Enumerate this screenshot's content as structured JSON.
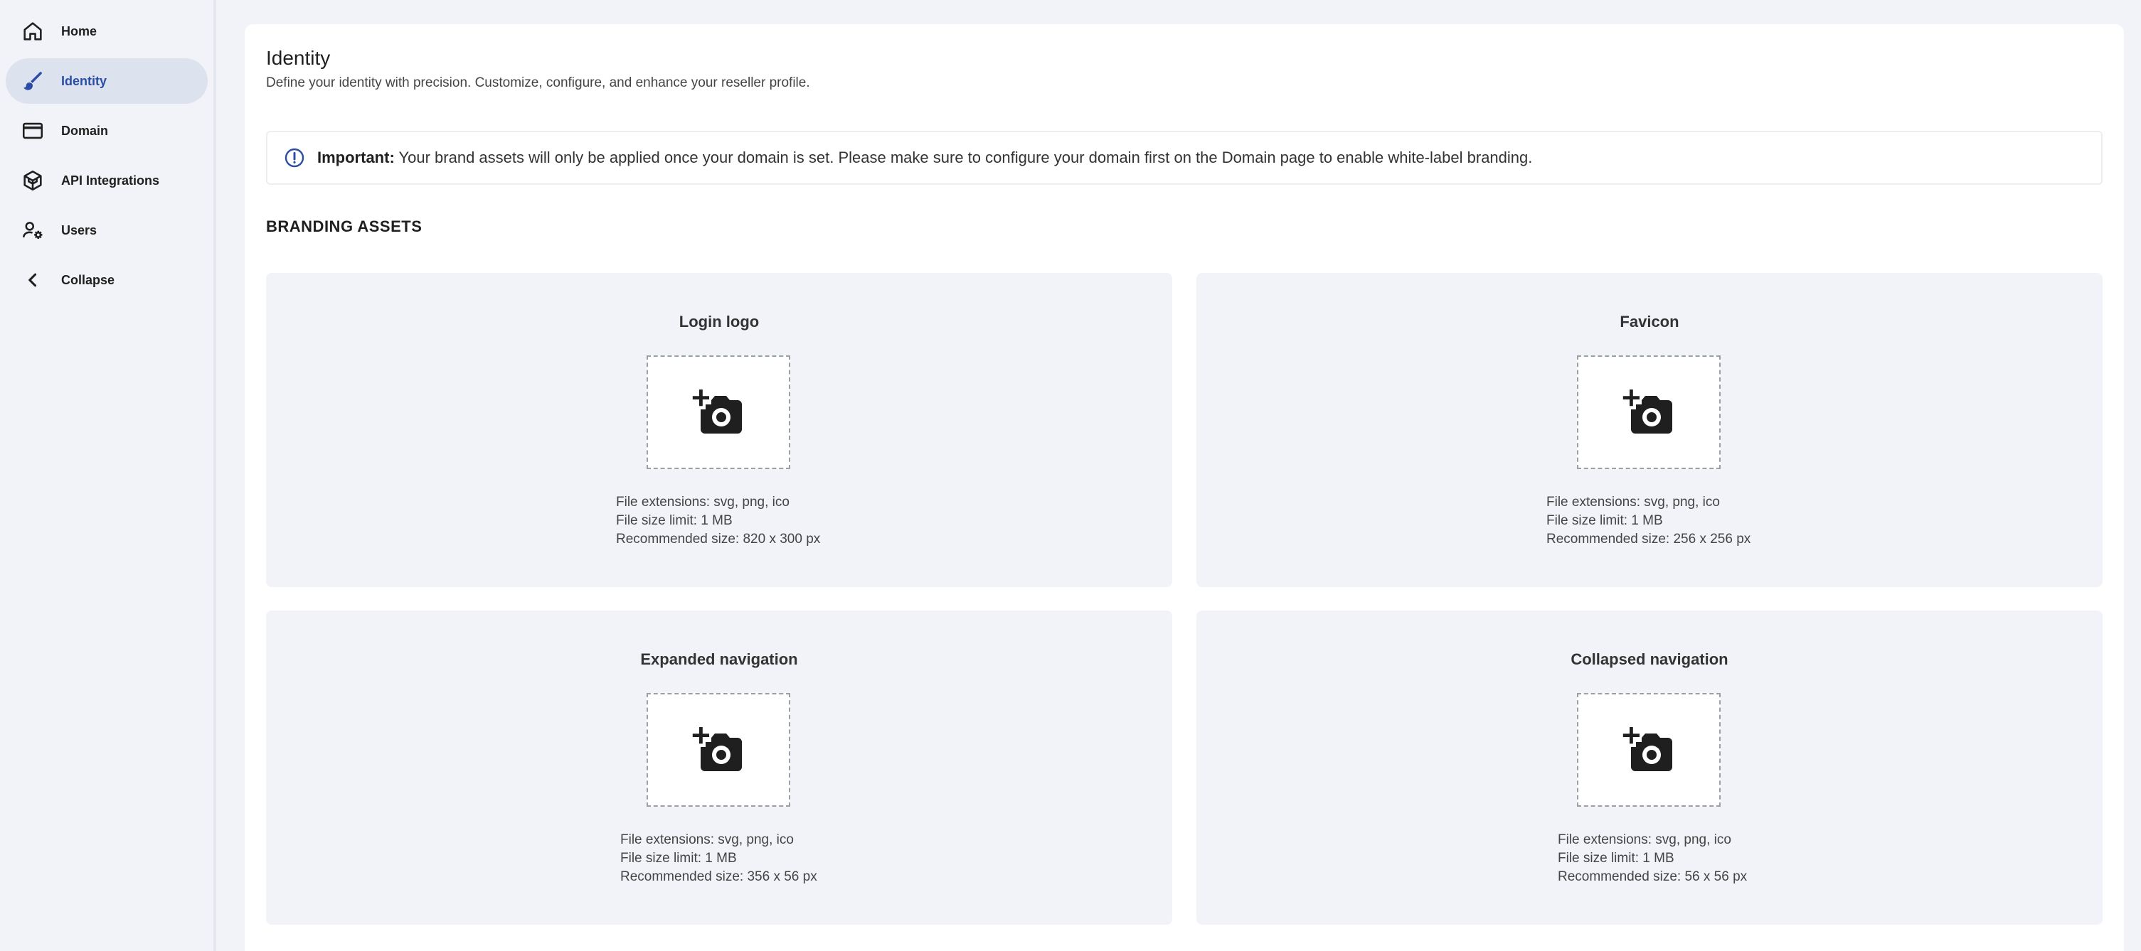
{
  "sidebar": {
    "items": [
      {
        "label": "Home",
        "icon": "home-icon"
      },
      {
        "label": "Identity",
        "icon": "brush-icon",
        "active": true
      },
      {
        "label": "Domain",
        "icon": "browser-window-icon"
      },
      {
        "label": "API Integrations",
        "icon": "cube-icon"
      },
      {
        "label": "Users",
        "icon": "user-settings-icon"
      },
      {
        "label": "Collapse",
        "icon": "chevron-left-icon"
      }
    ]
  },
  "header": {
    "title": "Identity",
    "subtitle": "Define your identity with precision. Customize, configure, and enhance your reseller profile."
  },
  "alert": {
    "icon": "info-circle-icon",
    "strong": "Important:",
    "message": " Your brand assets will only be applied once your domain is set. Please make sure to configure your domain first on the Domain page to enable white-label branding."
  },
  "section_title": "BRANDING ASSETS",
  "cards": [
    {
      "title": "Login logo",
      "extensions": "File extensions: svg, png, ico",
      "size_limit": "File size limit: 1 MB",
      "recommended": "Recommended size: 820 x 300 px"
    },
    {
      "title": "Favicon",
      "extensions": "File extensions: svg, png, ico",
      "size_limit": "File size limit: 1 MB",
      "recommended": "Recommended size: 256 x 256 px"
    },
    {
      "title": "Expanded navigation",
      "extensions": "File extensions: svg, png, ico",
      "size_limit": "File size limit: 1 MB",
      "recommended": "Recommended size: 356 x 56 px"
    },
    {
      "title": "Collapsed navigation",
      "extensions": "File extensions: svg, png, ico",
      "size_limit": "File size limit: 1 MB",
      "recommended": "Recommended size: 56 x 56 px"
    }
  ],
  "colors": {
    "accent": "#2a4ea6",
    "active_bg": "#dde2ef",
    "page_bg": "#f1f3f8",
    "card_bg": "#f1f3f8"
  }
}
